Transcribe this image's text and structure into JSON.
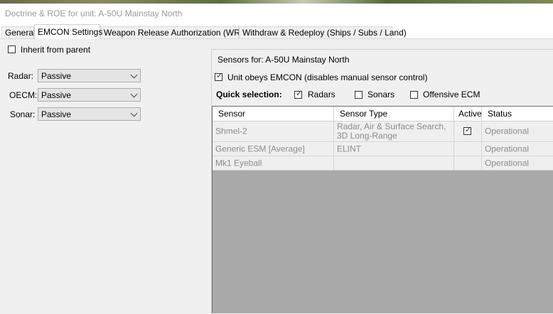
{
  "window": {
    "title": "Doctrine & ROE for unit: A-50U Mainstay North"
  },
  "tabs": [
    {
      "label": "General"
    },
    {
      "label": "EMCON Settings"
    },
    {
      "label": "Weapon Release Authorization (WRA)"
    },
    {
      "label": "Withdraw & Redeploy (Ships / Subs / Land)"
    }
  ],
  "left": {
    "inherit_label": "Inherit from parent",
    "inherit_checked": false,
    "radar_label": "Radar:",
    "radar_value": "Passive",
    "oecm_label": "OECM:",
    "oecm_value": "Passive",
    "sonar_label": "Sonar:",
    "sonar_value": "Passive"
  },
  "sensors": {
    "title": "Sensors for: A-50U Mainstay North",
    "obeys_label": "Unit obeys EMCON (disables manual sensor control)",
    "obeys_checked": true,
    "quick_label": "Quick selection:",
    "radars_label": "Radars",
    "radars_checked": true,
    "sonars_label": "Sonars",
    "sonars_checked": false,
    "ecm_label": "Offensive ECM",
    "ecm_checked": false,
    "columns": [
      "Sensor",
      "Sensor Type",
      "Active",
      "Status"
    ],
    "rows": [
      {
        "sensor": "Shmel-2",
        "type": "Radar, Air & Surface Search, 3D Long-Range",
        "active": true,
        "status": "Operational"
      },
      {
        "sensor": "Generic ESM [Average]",
        "type": "ELINT",
        "active": false,
        "status": "Operational"
      },
      {
        "sensor": "Mk1 Eyeball",
        "type": "",
        "active": false,
        "status": "Operational"
      }
    ]
  }
}
